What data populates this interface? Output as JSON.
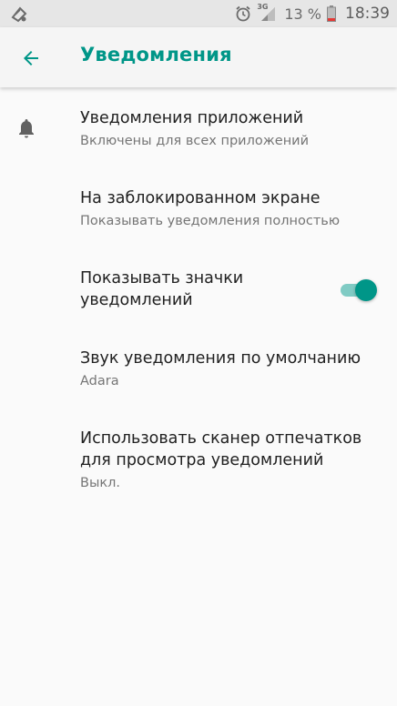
{
  "status_bar": {
    "network_type": "3G",
    "battery_percent": "13 %",
    "time": "18:39",
    "left_icon": "data-saver-icon",
    "alarm_icon": "alarm-icon",
    "signal_icon": "signal-icon",
    "battery_icon": "battery-low-icon"
  },
  "app_bar": {
    "title": "Уведомления",
    "back_icon": "arrow-back-icon"
  },
  "colors": {
    "accent": "#009688",
    "toggle_track": "#80cbc4",
    "battery_low": "#e53935"
  },
  "settings": {
    "items": [
      {
        "title": "Уведомления приложений",
        "summary": "Включены для всех приложений",
        "icon": "bell-icon"
      },
      {
        "title": "На заблокированном экране",
        "summary": "Показывать уведомления полностью"
      },
      {
        "title": "Показывать значки уведомлений",
        "toggle_on": true
      },
      {
        "title": "Звук уведомления по умолчанию",
        "summary": "Adara"
      },
      {
        "title": "Использовать сканер отпечатков для просмотра уведомлений",
        "summary": "Выкл."
      }
    ]
  }
}
